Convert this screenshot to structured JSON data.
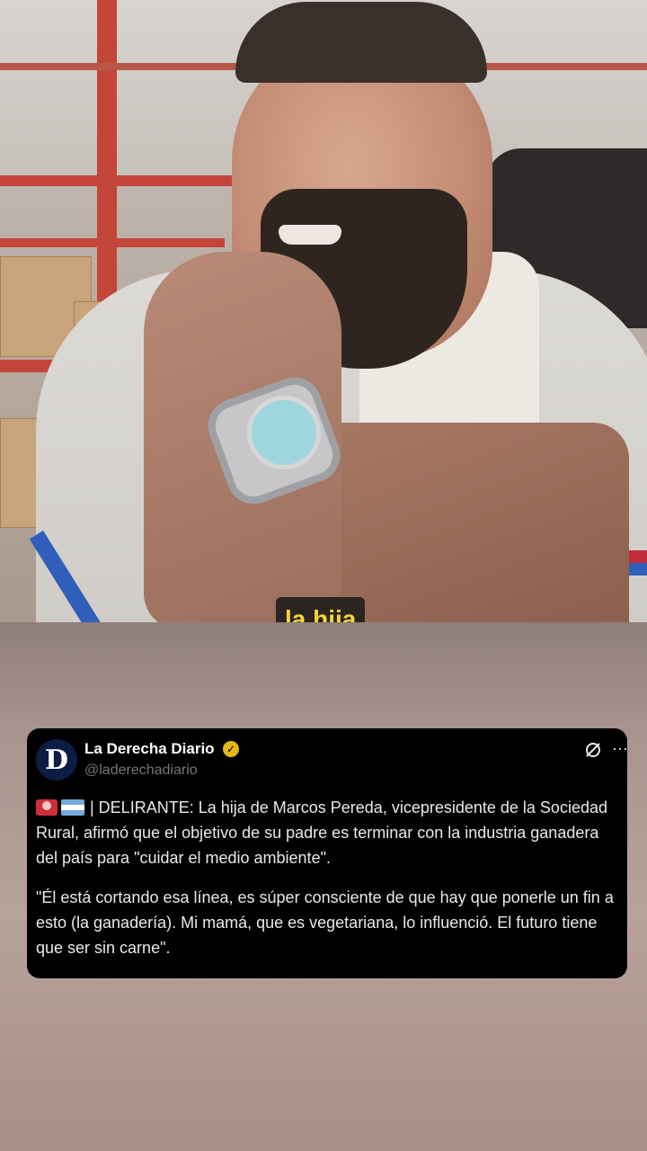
{
  "video": {
    "caption": "la hija"
  },
  "tweet": {
    "avatar_letter": "D",
    "display_name": "La Derecha Diario",
    "verified_icon": "verified-badge-icon",
    "handle": "@laderechadiario",
    "text_1": "| DELIRANTE: La hija de Marcos Pereda, vicepresidente de la Sociedad Rural, afirmó que el objetivo de su padre es terminar con la industria ganadera del país para \"cuidar el medio ambiente\".",
    "text_2": "\"Él está cortando esa línea, es súper consciente de que hay que ponerle un fin a esto (la ganadería). Mi mamá, que es vegetariana, lo influenció. El futuro tiene que ser sin carne\".",
    "more_label": "···"
  },
  "colors": {
    "caption_text": "#f4d53a",
    "caption_bg": "#2b2521",
    "card_bg": "#000000",
    "verified": "#e2b719"
  }
}
